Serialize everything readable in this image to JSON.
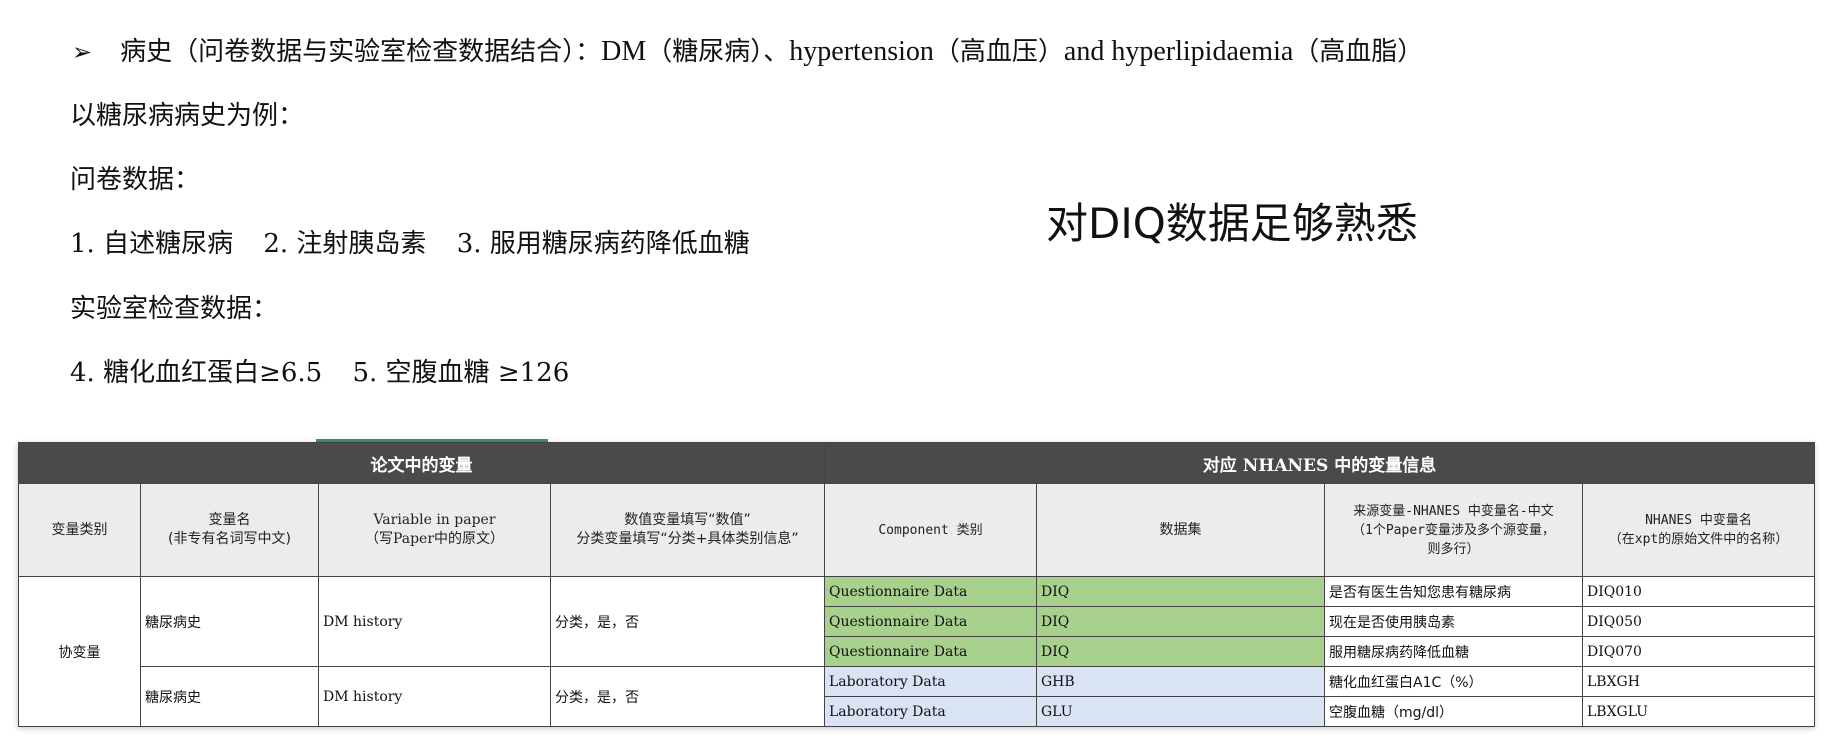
{
  "slide": {
    "bullet_symbol": "➢",
    "line1_prefix": "病史（问卷数据与实验室检查数据结合）：",
    "line1_dm": "DM",
    "line1_dm_cn": "（糖尿病）、",
    "line1_ht": "hypertension",
    "line1_ht_cn": "（高血压）",
    "line1_and": "and hyperlipidaemia",
    "line1_hl_cn": "（高血脂）",
    "line2": "以糖尿病病史为例：",
    "line3": "问卷数据：",
    "line4_items": [
      "1. 自述糖尿病",
      "2. 注射胰岛素",
      "3. 服用糖尿病药降低血糖"
    ],
    "line5": "实验室检查数据：",
    "line6_items": [
      "4. 糖化血红蛋白≥6.5",
      "5. 空腹血糖 ≥126"
    ],
    "side_note": "对DIQ数据足够熟悉"
  },
  "table": {
    "band_left": "论文中的变量",
    "band_right": "对应 NHANES 中的变量信息",
    "headers": [
      "变量类别",
      "变量名\n(非专有名词写中文)",
      "Variable in paper\n（写Paper中的原文）",
      "数值变量填写“数值”\n分类变量填写“分类+具体类别信息”",
      "Component 类别",
      "数据集",
      "来源变量-NHANES 中变量名-中文\n（1个Paper变量涉及多个源变量，\n则多行）",
      "NHANES 中变量名\n（在xpt的原始文件中的名称）"
    ],
    "category": "协变量",
    "groups": [
      {
        "name_cn": "糖尿病史",
        "name_en": "DM history",
        "value_type": "分类，是，否",
        "rows": [
          {
            "component": "Questionnaire Data",
            "dataset": "DIQ",
            "source_cn": "是否有医生告知您患有糖尿病",
            "var": "DIQ010"
          },
          {
            "component": "Questionnaire Data",
            "dataset": "DIQ",
            "source_cn": "现在是否使用胰岛素",
            "var": "DIQ050"
          },
          {
            "component": "Questionnaire Data",
            "dataset": "DIQ",
            "source_cn": "服用糖尿病药降低血糖",
            "var": "DIQ070"
          }
        ]
      },
      {
        "name_cn": "糖尿病史",
        "name_en": "DM history",
        "value_type": "分类，是，否",
        "rows": [
          {
            "component": "Laboratory Data",
            "dataset": "GHB",
            "source_cn": "糖化血红蛋白A1C（%）",
            "var": "LBXGH"
          },
          {
            "component": "Laboratory Data",
            "dataset": "GLU",
            "source_cn": "空腹血糖（mg/dl）",
            "var": "LBXGLU"
          }
        ]
      }
    ]
  }
}
